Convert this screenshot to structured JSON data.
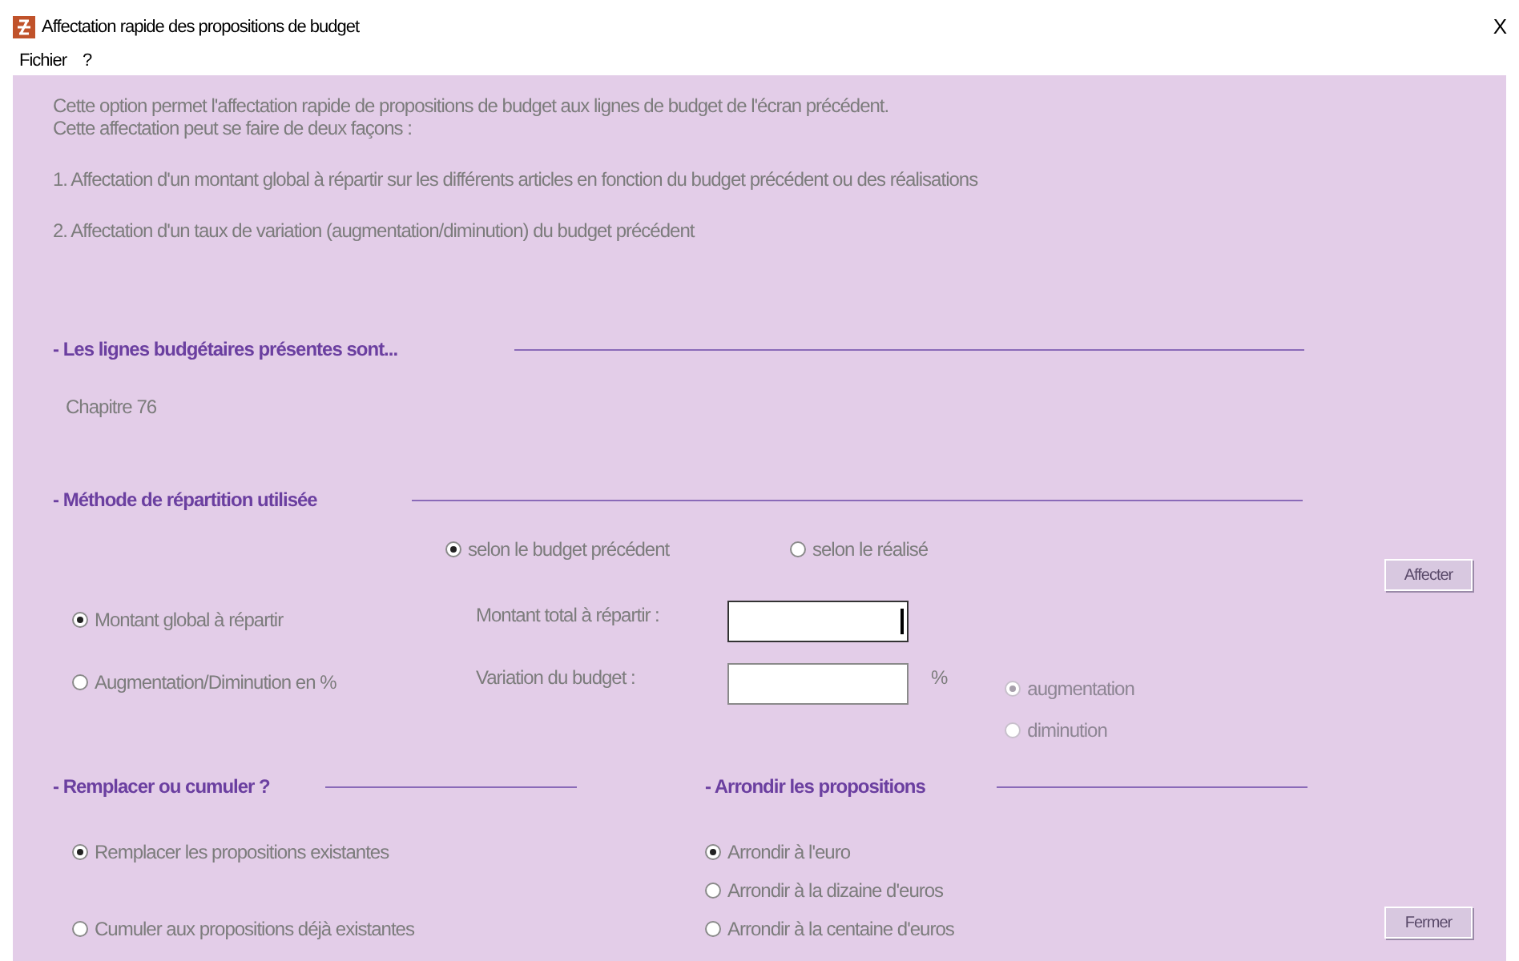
{
  "window": {
    "title": "Affectation rapide des propositions de budget",
    "close": "X"
  },
  "menu": [
    "Fichier",
    "?"
  ],
  "intro": [
    "Cette option permet l'affectation rapide de propositions de budget aux lignes de budget de l'écran précédent.",
    "Cette affectation peut se faire de deux façons :"
  ],
  "options_text": [
    "1. Affectation d'un montant global à répartir sur les différents articles en fonction du budget précédent ou des réalisations",
    "2. Affectation d'un taux de variation (augmentation/diminution) du budget précédent"
  ],
  "lines_section": {
    "heading": "- Les lignes budgétaires présentes sont...",
    "items": [
      "Chapitre 76"
    ]
  },
  "method_section": {
    "heading": "- Méthode de répartition utilisée",
    "basis": [
      {
        "label": "selon le budget précédent",
        "selected": true
      },
      {
        "label": "selon le réalisé",
        "selected": false
      }
    ],
    "affect_button": "Affecter",
    "modes": [
      {
        "label": "Montant global à répartir",
        "selected": true,
        "field_label": "Montant total à répartir :",
        "focused": true
      },
      {
        "label": "Augmentation/Diminution en %",
        "selected": false,
        "field_label": "Variation du budget :",
        "focused": false,
        "unit": "%"
      }
    ],
    "direction": [
      {
        "label": "augmentation",
        "selected": true,
        "disabled": true
      },
      {
        "label": "diminution",
        "selected": false,
        "disabled": true
      }
    ]
  },
  "replace_section": {
    "heading": "- Remplacer ou cumuler ?",
    "options": [
      {
        "label": "Remplacer les propositions existantes",
        "selected": true
      },
      {
        "label": "Cumuler aux propositions déjà existantes",
        "selected": false
      }
    ]
  },
  "round_section": {
    "heading": "- Arrondir les propositions",
    "options": [
      {
        "label": "Arrondir à l'euro",
        "selected": true
      },
      {
        "label": "Arrondir à la dizaine d'euros",
        "selected": false
      },
      {
        "label": "Arrondir à la centaine d'euros",
        "selected": false
      }
    ]
  },
  "close_button": "Fermer"
}
